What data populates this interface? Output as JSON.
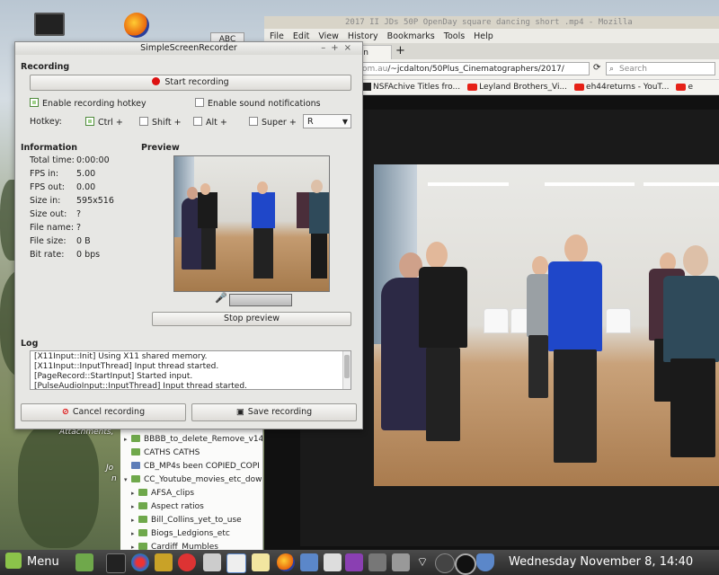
{
  "desktop": {
    "abc_label": "ABC",
    "sidebar_text": [
      "Attachments,",
      "Jo",
      "n"
    ]
  },
  "firefox": {
    "title": "2017 II JDs 50P OpenDay square dancing short .mp4 - Mozilla",
    "menu": [
      "File",
      "Edit",
      "View",
      "History",
      "Bookmarks",
      "Tools",
      "Help"
    ],
    "tab_label": "pen",
    "new_tab": "+",
    "url_host": "om.au",
    "url_path": "/~jcdalton/50Plus_Cinematographers/2017/",
    "search_placeholder": "Search",
    "bookmarks": [
      "NSFAchive Titles fro...",
      "Leyland Brothers_Vi...",
      "eh44returns - YouT...",
      "e"
    ]
  },
  "ssr": {
    "title": "SimpleScreenRecorder",
    "recording_section": "Recording",
    "start_recording": "Start recording",
    "enable_hotkey": "Enable recording hotkey",
    "enable_sound": "Enable sound notifications",
    "hotkey_label": "Hotkey:",
    "ctrl": "Ctrl +",
    "shift": "Shift +",
    "alt": "Alt +",
    "super": "Super +",
    "key": "R",
    "info_section": "Information",
    "preview_section": "Preview",
    "info": [
      {
        "label": "Total time:",
        "value": "0:00:00"
      },
      {
        "label": "FPS in:",
        "value": "5.00"
      },
      {
        "label": "FPS out:",
        "value": "0.00"
      },
      {
        "label": "Size in:",
        "value": "595x516"
      },
      {
        "label": "Size out:",
        "value": "?"
      },
      {
        "label": "File name:",
        "value": "?"
      },
      {
        "label": "File size:",
        "value": "0 B"
      },
      {
        "label": "Bit rate:",
        "value": "0 bps"
      }
    ],
    "stop_preview": "Stop preview",
    "log_section": "Log",
    "log": [
      "[X11Input::Init] Using X11 shared memory.",
      "[X11Input::InputThread] Input thread started.",
      "[PageRecord::StartInput] Started input.",
      "[PulseAudioInput::InputThread] Input thread started."
    ],
    "cancel_recording": "Cancel recording",
    "save_recording": "Save recording"
  },
  "filemanager": {
    "items": [
      {
        "name": "BBBB_to_delete_Remove_v14",
        "expander": "▸"
      },
      {
        "name": "CATHS          CATHS",
        "expander": ""
      },
      {
        "name": "CB_MP4s been COPIED_COPI",
        "expander": ""
      },
      {
        "name": "CC_Youtube_movies_etc_down",
        "expander": "▾"
      },
      {
        "name": "AFSA_clips",
        "expander": "▸"
      },
      {
        "name": "Aspect ratios",
        "expander": "▸"
      },
      {
        "name": "Bill_Collins_yet_to_use",
        "expander": "▸"
      },
      {
        "name": "Biogs_Ledgions_etc",
        "expander": "▸"
      },
      {
        "name": "Cardiff_Mumbles",
        "expander": "▸"
      }
    ]
  },
  "taskbar": {
    "menu_label": "Menu",
    "clock": "Wednesday November  8, 14:40"
  }
}
